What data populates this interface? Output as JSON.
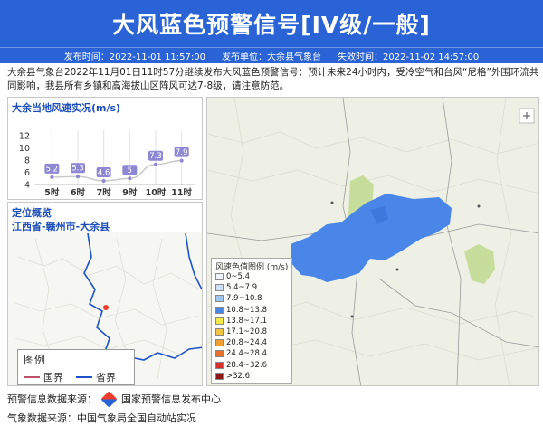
{
  "header": {
    "title": "大风蓝色预警信号[IV级/一般]",
    "publish_time": "发布时间：2022-11-01 11:57:00",
    "publisher": "发布单位：大余县气象台",
    "expire_time": "失效时间：2022-11-02 14:57:00",
    "accent": "#2a63d6"
  },
  "description": "大余县气象台2022年11月01日11时57分继续发布大风蓝色预警信号：预计未来24小时内，受冷空气和台风“尼格”外围环流共同影响，我县所有乡镇和高海拔山区阵风可达7-8级，请注意防范。",
  "wind_panel": {
    "title": "大余当地风速实况(m/s)"
  },
  "chart_data": {
    "type": "line",
    "title": "大余当地风速实况(m/s)",
    "categories": [
      "5时",
      "6时",
      "7时",
      "9时",
      "10时",
      "11时"
    ],
    "values": [
      5.2,
      5.3,
      4.6,
      5,
      7.3,
      7.9
    ],
    "value_labels": [
      "5.2",
      "5.3",
      "4.6",
      "5",
      "7.3",
      "7.9"
    ],
    "yticks": [
      "4",
      "6",
      "8",
      "10",
      "12"
    ],
    "ylim": [
      4,
      12
    ],
    "grid": true,
    "label_color": "#8e87d3",
    "line_color": "#c9c9c9"
  },
  "location_panel": {
    "title": "定位概览",
    "subtitle": "江西省-赣州市-大余县",
    "legend_title": "图例",
    "legend_country": "国界",
    "legend_province": "省界",
    "country_color": "#c0506a",
    "province_color": "#1d52c8"
  },
  "map_panel": {
    "legend_title": "风速色值图例 (m/s)",
    "legend_items": [
      {
        "label": "0~5.4",
        "color": "#eef3fb"
      },
      {
        "label": "5.4~7.9",
        "color": "#cfe1f7"
      },
      {
        "label": "7.9~10.8",
        "color": "#9ec8f0"
      },
      {
        "label": "10.8~13.8",
        "color": "#4a86e8"
      },
      {
        "label": "13.8~17.1",
        "color": "#f5e94a"
      },
      {
        "label": "17.1~20.8",
        "color": "#f4c542"
      },
      {
        "label": "20.8~24.4",
        "color": "#f0a030"
      },
      {
        "label": "24.4~28.4",
        "color": "#e8702a"
      },
      {
        "label": "28.4~32.6",
        "color": "#d6302a"
      },
      {
        "label": ">32.6",
        "color": "#8e1616"
      }
    ],
    "county_color": "#4a86e8"
  },
  "sources": {
    "warning_prefix": "预警信息数据来源：",
    "warning_org": "国家预警信息发布中心",
    "weather": "气象数据来源：中国气象局全国自动站实况"
  }
}
